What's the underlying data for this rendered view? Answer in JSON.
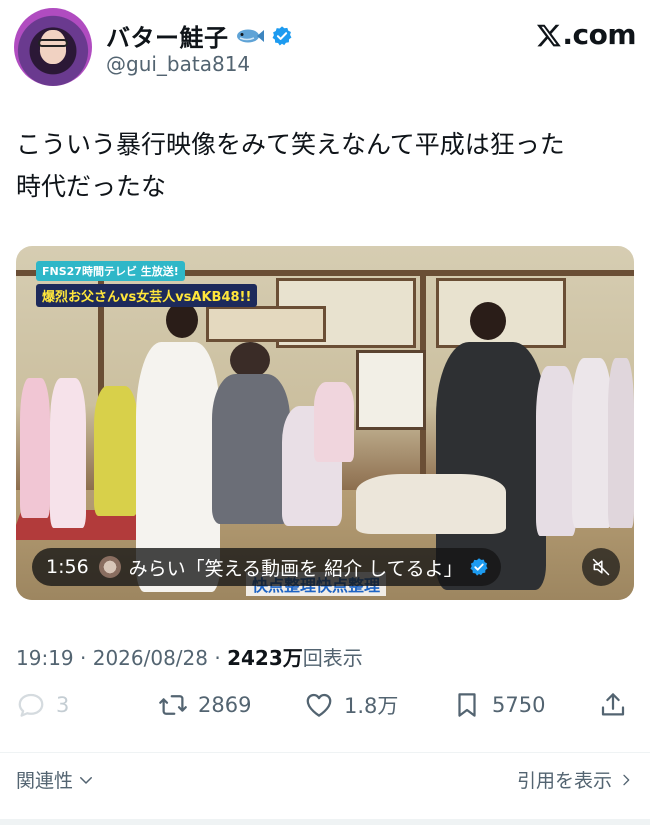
{
  "author": {
    "display_name": "バター鮭子",
    "handle": "@gui_bata814",
    "verified_color": "#1d9bf0"
  },
  "brand": {
    "text": ".com"
  },
  "tweet": {
    "line1": "こういう暴行映像をみて笑えなんて平成は狂った",
    "line2": "時代だったな"
  },
  "media": {
    "banner_top": "FNS27時間テレビ 生放送!",
    "banner_bottom": "爆烈お父さんvs女芸人vsAKB48!!",
    "caption": "快点整理快点整理",
    "duration": "1:56",
    "pill_text": "みらい「笑える動画を 紹介 してるよ」"
  },
  "meta": {
    "time": "19:19",
    "date": "2026/08/28",
    "views_number": "2423万",
    "views_suffix": "回表示",
    "sep": "·"
  },
  "actions": {
    "replies": "3",
    "reposts": "2869",
    "likes": "1.8万",
    "bookmarks": "5750"
  },
  "footer": {
    "left_label": "関連性",
    "right_label": "引用を表示"
  },
  "colors": {
    "text": "#0f1419",
    "secondary": "#536471",
    "accent": "#1d9bf0"
  }
}
